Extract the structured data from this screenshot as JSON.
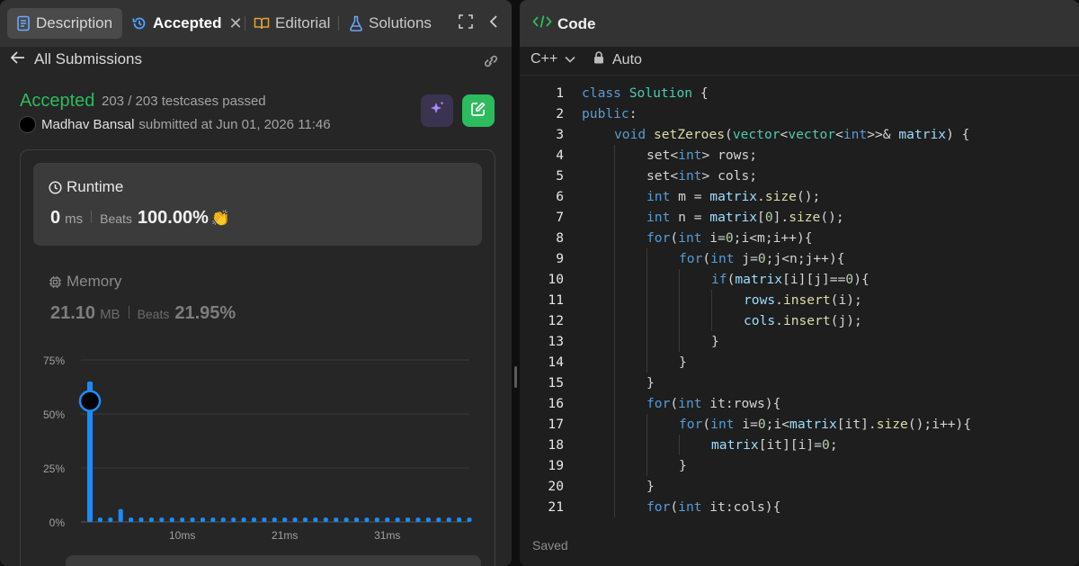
{
  "tabs": {
    "description": "Description",
    "accepted": "Accepted",
    "editorial": "Editorial",
    "solutions": "Solutions"
  },
  "subheader": {
    "back_label": "All Submissions"
  },
  "submission": {
    "status": "Accepted",
    "testcases": "203 / 203 testcases passed",
    "user": "Madhav Bansal",
    "submitted_text": "submitted at Jun 01, 2026 11:46"
  },
  "runtime": {
    "title": "Runtime",
    "value": "0",
    "unit": "ms",
    "beats_label": "Beats",
    "beats_value": "100.00%"
  },
  "memory": {
    "title": "Memory",
    "value": "21.10",
    "unit": "MB",
    "beats_label": "Beats",
    "beats_value": "21.95%"
  },
  "chart_data": {
    "type": "bar",
    "y_tick_labels": [
      "75%",
      "50%",
      "25%",
      "0%"
    ],
    "x_tick_labels": [
      "10ms",
      "21ms",
      "31ms"
    ],
    "ylim": [
      0,
      75
    ],
    "values": [
      65,
      2,
      2,
      6,
      2,
      2,
      2,
      2,
      2,
      2,
      2,
      2,
      2,
      2,
      2,
      2,
      2,
      2,
      2,
      2,
      2,
      2,
      2,
      2,
      2,
      2,
      2,
      2,
      2,
      2,
      2,
      2,
      2,
      2,
      2,
      2,
      2,
      2
    ],
    "highlight_index": 0,
    "highlight_value": 56,
    "colors": {
      "bar": "#1a8cff",
      "grid": "#3a3a3a",
      "tick": "#a0a0a0"
    }
  },
  "code_panel": {
    "title": "Code",
    "language": "C++",
    "mode": "Auto",
    "status": "Saved",
    "lines": [
      {
        "n": "1",
        "i": 0,
        "t": [
          [
            "kw",
            "class"
          ],
          [
            "",
            "",
            " "
          ],
          [
            "ty",
            "Solution"
          ],
          [
            "",
            " {"
          ]
        ]
      },
      {
        "n": "2",
        "i": 0,
        "t": [
          [
            "kw",
            "public"
          ],
          [
            "",
            ":"
          ]
        ]
      },
      {
        "n": "3",
        "i": 1,
        "t": [
          [
            "kw",
            "void"
          ],
          [
            "",
            " "
          ],
          [
            "fn",
            "setZeroes"
          ],
          [
            "",
            "("
          ],
          [
            "ty",
            "vector"
          ],
          [
            "",
            "<"
          ],
          [
            "ty",
            "vector"
          ],
          [
            "",
            "<"
          ],
          [
            "kw",
            "int"
          ],
          [
            "",
            ">>& "
          ],
          [
            "var",
            "matrix"
          ],
          [
            "",
            ") {"
          ]
        ]
      },
      {
        "n": "4",
        "i": 2,
        "t": [
          [
            "",
            "set<"
          ],
          [
            "kw",
            "int"
          ],
          [
            "",
            "> rows;"
          ]
        ]
      },
      {
        "n": "5",
        "i": 2,
        "t": [
          [
            "",
            "set<"
          ],
          [
            "kw",
            "int"
          ],
          [
            "",
            "> cols;"
          ]
        ]
      },
      {
        "n": "6",
        "i": 2,
        "t": [
          [
            "kw",
            "int"
          ],
          [
            "",
            " m = "
          ],
          [
            "var",
            "matrix"
          ],
          [
            "",
            "."
          ],
          [
            "fn",
            "size"
          ],
          [
            "",
            "();"
          ]
        ]
      },
      {
        "n": "7",
        "i": 2,
        "t": [
          [
            "kw",
            "int"
          ],
          [
            "",
            " n = "
          ],
          [
            "var",
            "matrix"
          ],
          [
            "",
            "["
          ],
          [
            "num",
            "0"
          ],
          [
            "",
            "]."
          ],
          [
            "fn",
            "size"
          ],
          [
            "",
            "();"
          ]
        ]
      },
      {
        "n": "8",
        "i": 2,
        "t": [
          [
            "kw",
            "for"
          ],
          [
            "",
            "("
          ],
          [
            "kw",
            "int"
          ],
          [
            "",
            " i="
          ],
          [
            "num",
            "0"
          ],
          [
            "",
            ";i<m;i++){"
          ]
        ]
      },
      {
        "n": "9",
        "i": 3,
        "t": [
          [
            "kw",
            "for"
          ],
          [
            "",
            "("
          ],
          [
            "kw",
            "int"
          ],
          [
            "",
            " j="
          ],
          [
            "num",
            "0"
          ],
          [
            "",
            ";j<n;j++){"
          ]
        ]
      },
      {
        "n": "10",
        "i": 4,
        "t": [
          [
            "kw",
            "if"
          ],
          [
            "",
            "("
          ],
          [
            "var",
            "matrix"
          ],
          [
            "",
            "[i][j]=="
          ],
          [
            "num",
            "0"
          ],
          [
            "",
            "){"
          ]
        ]
      },
      {
        "n": "11",
        "i": 5,
        "t": [
          [
            "var",
            "rows"
          ],
          [
            "",
            "."
          ],
          [
            "fn",
            "insert"
          ],
          [
            "",
            "(i);"
          ]
        ]
      },
      {
        "n": "12",
        "i": 5,
        "t": [
          [
            "var",
            "cols"
          ],
          [
            "",
            "."
          ],
          [
            "fn",
            "insert"
          ],
          [
            "",
            "(j);"
          ]
        ]
      },
      {
        "n": "13",
        "i": 4,
        "t": [
          [
            "",
            "}"
          ]
        ]
      },
      {
        "n": "14",
        "i": 3,
        "t": [
          [
            "",
            "}"
          ]
        ]
      },
      {
        "n": "15",
        "i": 2,
        "t": [
          [
            "",
            "}"
          ]
        ]
      },
      {
        "n": "16",
        "i": 2,
        "t": [
          [
            "kw",
            "for"
          ],
          [
            "",
            "("
          ],
          [
            "kw",
            "int"
          ],
          [
            "",
            " it:rows){"
          ]
        ]
      },
      {
        "n": "17",
        "i": 3,
        "t": [
          [
            "kw",
            "for"
          ],
          [
            "",
            "("
          ],
          [
            "kw",
            "int"
          ],
          [
            "",
            " i="
          ],
          [
            "num",
            "0"
          ],
          [
            "",
            ";i<"
          ],
          [
            "var",
            "matrix"
          ],
          [
            "",
            "[it]."
          ],
          [
            "fn",
            "size"
          ],
          [
            "",
            "();i++){"
          ]
        ]
      },
      {
        "n": "18",
        "i": 4,
        "t": [
          [
            "var",
            "matrix"
          ],
          [
            "",
            "[it][i]="
          ],
          [
            "num",
            "0"
          ],
          [
            "",
            ";"
          ]
        ]
      },
      {
        "n": "19",
        "i": 3,
        "t": [
          [
            "",
            "}"
          ]
        ]
      },
      {
        "n": "20",
        "i": 2,
        "t": [
          [
            "",
            "}"
          ]
        ]
      },
      {
        "n": "21",
        "i": 2,
        "t": [
          [
            "kw",
            "for"
          ],
          [
            "",
            "("
          ],
          [
            "kw",
            "int"
          ],
          [
            "",
            " it:cols){"
          ]
        ]
      }
    ]
  }
}
